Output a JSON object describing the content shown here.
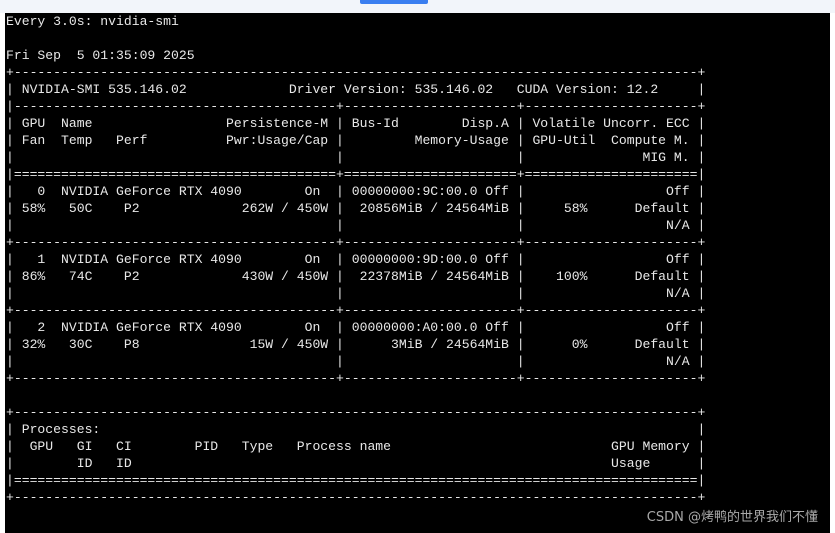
{
  "browser": {
    "tab_indicator_color": "#3a7ef0"
  },
  "terminal": {
    "header_line": "Every 3.0s: nvidia-smi",
    "timestamp": "Fri Sep  5 01:35:09 2025",
    "output_lines": [
      "+---------------------------------------------------------------------------------------+",
      "| NVIDIA-SMI 535.146.02             Driver Version: 535.146.02   CUDA Version: 12.2     |",
      "|-----------------------------------------+----------------------+----------------------+",
      "| GPU  Name                 Persistence-M | Bus-Id        Disp.A | Volatile Uncorr. ECC |",
      "| Fan  Temp   Perf          Pwr:Usage/Cap |         Memory-Usage | GPU-Util  Compute M. |",
      "|                                         |                      |               MIG M. |",
      "|=========================================+======================+======================|",
      "|   0  NVIDIA GeForce RTX 4090        On  | 00000000:9C:00.0 Off |                  Off |",
      "| 58%   50C    P2             262W / 450W |  20856MiB / 24564MiB |     58%      Default |",
      "|                                         |                      |                  N/A |",
      "+-----------------------------------------+----------------------+----------------------+",
      "|   1  NVIDIA GeForce RTX 4090        On  | 00000000:9D:00.0 Off |                  Off |",
      "| 86%   74C    P2             430W / 450W |  22378MiB / 24564MiB |    100%      Default |",
      "|                                         |                      |                  N/A |",
      "+-----------------------------------------+----------------------+----------------------+",
      "|   2  NVIDIA GeForce RTX 4090        On  | 00000000:A0:00.0 Off |                  Off |",
      "| 32%   30C    P8              15W / 450W |      3MiB / 24564MiB |      0%      Default |",
      "|                                         |                      |                  N/A |",
      "+-----------------------------------------+----------------------+----------------------+",
      "",
      "+---------------------------------------------------------------------------------------+",
      "| Processes:                                                                            |",
      "|  GPU   GI   CI        PID   Type   Process name                            GPU Memory |",
      "|        ID   ID                                                             Usage      |",
      "|=======================================================================================|",
      "+---------------------------------------------------------------------------------------+"
    ],
    "text_color": "#e8e8e8",
    "background_color": "#000000"
  },
  "watermark": {
    "text": "CSDN @烤鸭的世界我们不懂"
  }
}
